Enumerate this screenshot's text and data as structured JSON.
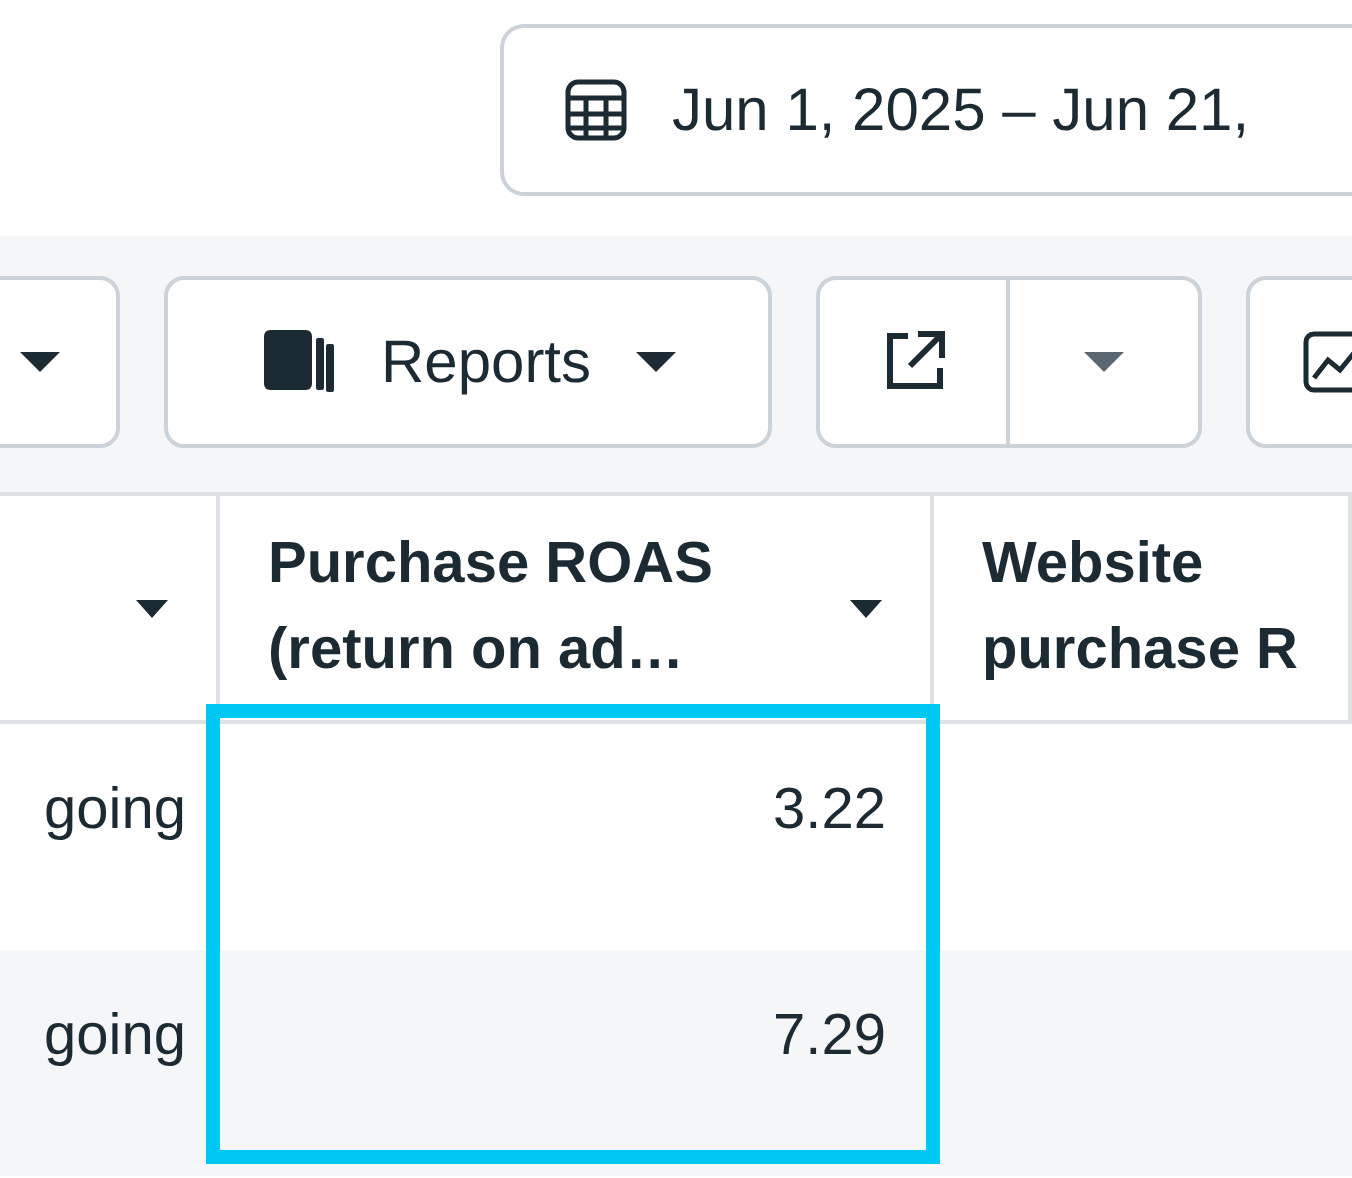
{
  "date_range": {
    "label": "Jun 1, 2025 – Jun 21,"
  },
  "toolbar": [
    {
      "kind": "dropdown"
    },
    {
      "kind": "menu",
      "label": "Reports"
    },
    {
      "kind": "split"
    },
    {
      "kind": "chart"
    }
  ],
  "table": {
    "columns": [
      {
        "sort_caret": true,
        "highlighted": false
      },
      {
        "label": "Purchase ROAS (return on ad…",
        "sort_caret": true,
        "highlighted": true
      },
      {
        "label": "Website purchase R",
        "sort_caret": false,
        "highlighted": false
      }
    ],
    "rows": [
      {
        "column_1": "going",
        "column_2": "3.22"
      },
      {
        "column_1": "going",
        "column_2": "7.29"
      }
    ]
  }
}
